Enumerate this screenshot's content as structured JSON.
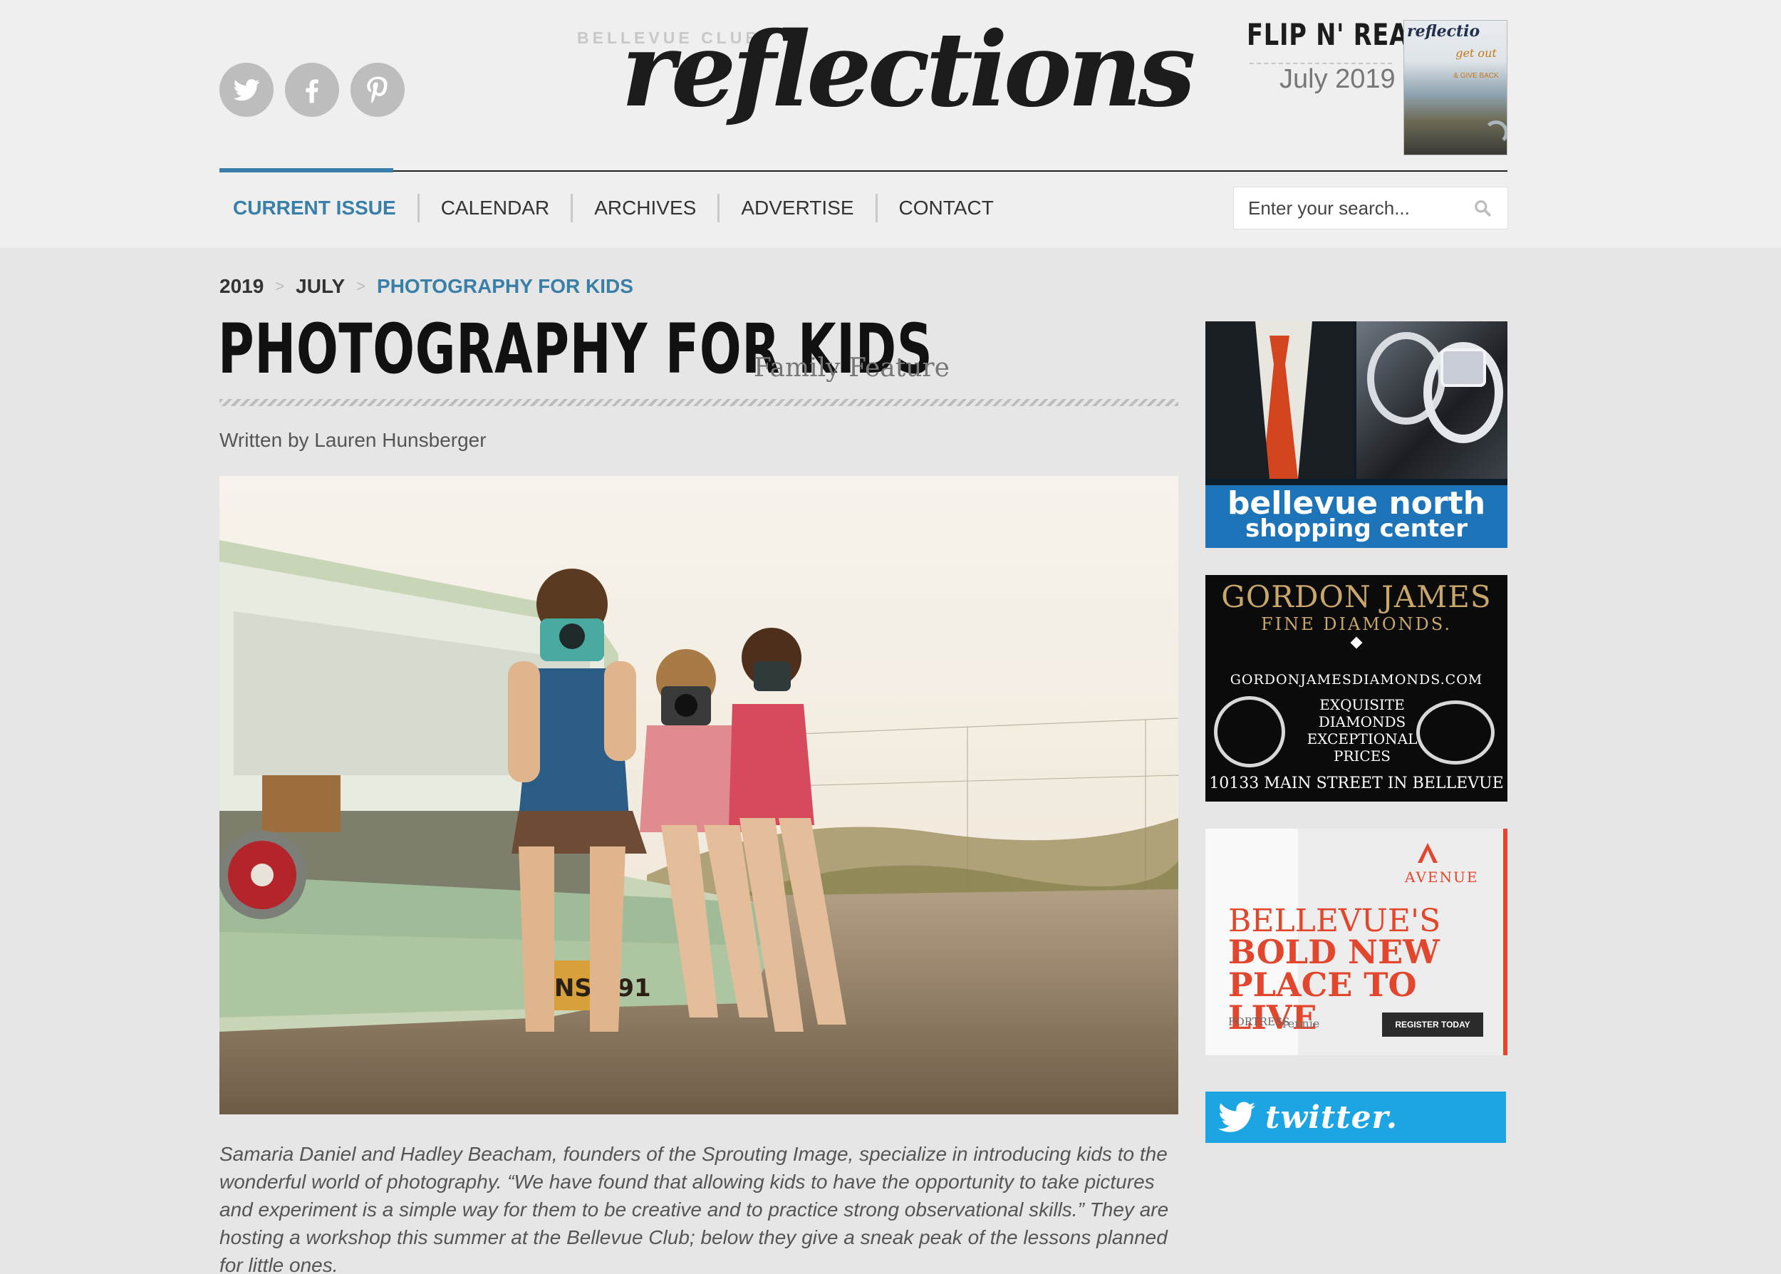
{
  "header": {
    "social": [
      {
        "name": "twitter-icon",
        "label": "Twitter"
      },
      {
        "name": "facebook-icon",
        "label": "Facebook"
      },
      {
        "name": "pinterest-icon",
        "label": "Pinterest"
      }
    ],
    "logo_small": "BELLEVUE CLUB",
    "logo_main": "reflections",
    "flip_title": "FLIP N' READ",
    "flip_date": "July 2019",
    "cover": {
      "title": "reflectio",
      "tagline": "get out",
      "subtag": "& GIVE BACK"
    }
  },
  "nav": {
    "items": [
      "CURRENT ISSUE",
      "CALENDAR",
      "ARCHIVES",
      "ADVERTISE",
      "CONTACT"
    ],
    "active_index": 0
  },
  "search": {
    "placeholder": "Enter your search..."
  },
  "breadcrumb": [
    "2019",
    "JULY",
    "PHOTOGRAPHY FOR KIDS"
  ],
  "article": {
    "title": "PHOTOGRAPHY FOR KIDS",
    "category": "Family Feature",
    "author": "Written by Lauren Hunsberger",
    "plate": "GNS 291",
    "intro": "Samaria Daniel and Hadley Beacham, founders of the Sprouting Image, specialize in introducing kids to the wonderful world of photography. “We have found that allowing kids to have the opportunity to take pictures and experiment is a simple way for them to be creative and to practice strong observational skills.” They are hosting a workshop this summer at the Bellevue Club; below they give a sneak peak of the lessons planned for little ones."
  },
  "sidebar": {
    "ad1": {
      "line1": "bellevue north",
      "line2": "shopping center"
    },
    "ad2": {
      "brand": "GORDON JAMES",
      "sub": "FINE DIAMONDS.",
      "url": "GORDONJAMESDIAMONDS.COM",
      "copy1": "EXQUISITE DIAMONDS",
      "copy2": "EXCEPTIONAL",
      "copy3": "PRICES",
      "address": "10133 MAIN STREET IN BELLEVUE"
    },
    "ad3": {
      "logo": "AVENUE",
      "line1": "BELLEVUE'S",
      "line2": "BOLD NEW",
      "line3": "PLACE TO LIVE",
      "partner1": "FORTRESS",
      "partner2": "rennie",
      "cta": "REGISTER TODAY"
    },
    "twitter_label": "twitter."
  },
  "colors": {
    "accent": "#3a7fa8",
    "twitter": "#1ca4e3",
    "ad_blue": "#1d74b9",
    "ad_red": "#e2462c",
    "gold": "#c9a66b"
  }
}
